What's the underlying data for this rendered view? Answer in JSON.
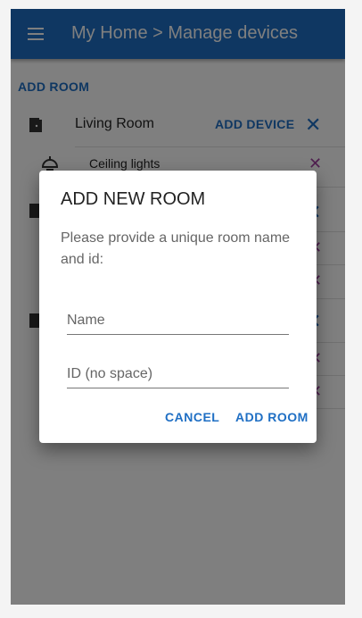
{
  "appbar": {
    "title": "My Home > Manage devices",
    "menu_icon": "menu-icon"
  },
  "page": {
    "add_room_label": "ADD ROOM",
    "rooms": [
      {
        "name": "Living Room",
        "add_device_label": "ADD DEVICE",
        "devices": [
          {
            "name": "Ceiling lights"
          }
        ]
      }
    ]
  },
  "dialog": {
    "title": "ADD NEW ROOM",
    "description": "Please provide a unique room name and id:",
    "name_placeholder": "Name",
    "id_placeholder": "ID (no space)",
    "cancel_label": "CANCEL",
    "confirm_label": "ADD ROOM"
  },
  "colors": {
    "primary": "#1f6fc4",
    "delete_accent": "#a040a0",
    "scrim": "rgba(0,0,0,0.5)"
  }
}
